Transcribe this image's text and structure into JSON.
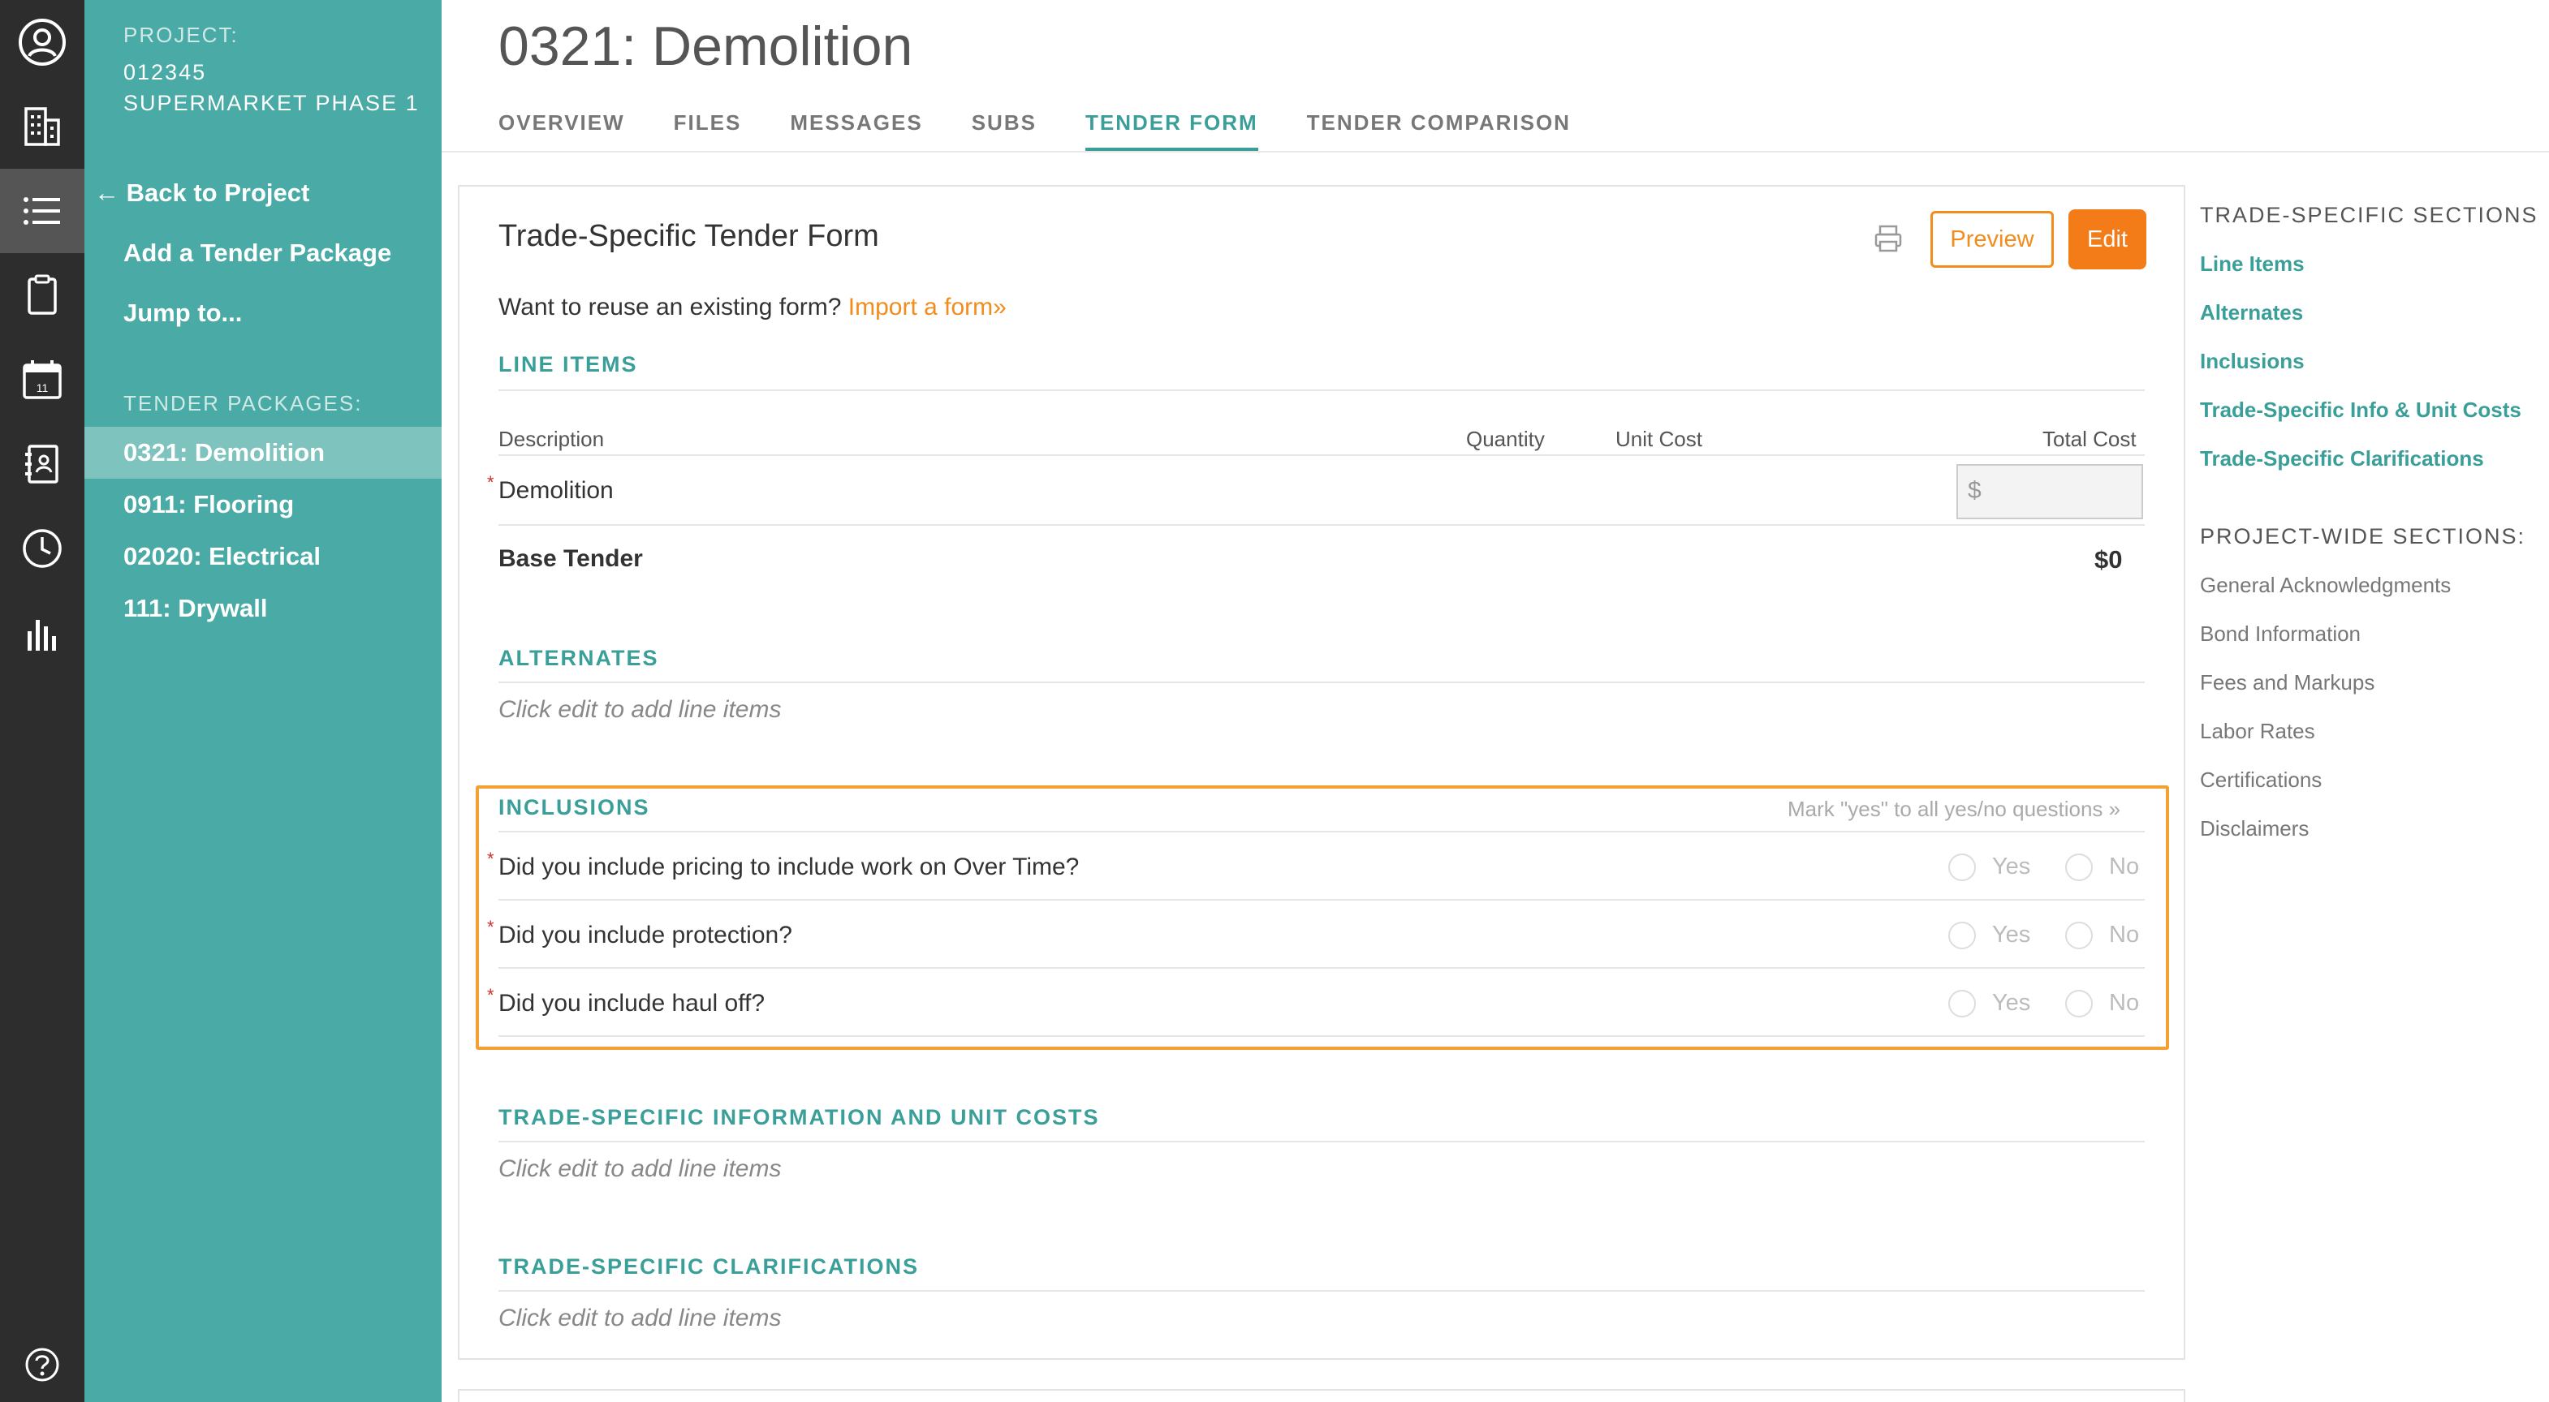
{
  "rail": {
    "items": [
      {
        "icon": "user-icon"
      },
      {
        "icon": "building-icon"
      },
      {
        "icon": "list-icon"
      },
      {
        "icon": "clipboard-icon"
      },
      {
        "icon": "calendar-icon",
        "day": "11"
      },
      {
        "icon": "address-book-icon"
      },
      {
        "icon": "clock-icon"
      },
      {
        "icon": "bar-chart-icon"
      },
      {
        "icon": "help-icon"
      }
    ]
  },
  "sidebar": {
    "project_label": "PROJECT:",
    "project_number": "012345",
    "project_name": "SUPERMARKET PHASE 1",
    "back_link": "← Back to Project",
    "add_package": "Add a Tender Package",
    "jump_to": "Jump to...",
    "packages_label": "TENDER PACKAGES:",
    "packages": [
      "0321: Demolition",
      "0911: Flooring",
      "02020: Electrical",
      "111: Drywall"
    ],
    "active_package": "0321: Demolition"
  },
  "header": {
    "title": "0321: Demolition",
    "tabs": [
      "OVERVIEW",
      "FILES",
      "MESSAGES",
      "SUBS",
      "TENDER FORM",
      "TENDER COMPARISON"
    ],
    "active_tab": "TENDER FORM"
  },
  "form": {
    "title": "Trade-Specific Tender Form",
    "preview_label": "Preview",
    "edit_label": "Edit",
    "reuse_text": "Want to reuse an existing form?",
    "import_link": "Import a form»",
    "line_items": {
      "heading": "LINE ITEMS",
      "columns": {
        "description": "Description",
        "quantity": "Quantity",
        "unit_cost": "Unit Cost",
        "total_cost": "Total Cost"
      },
      "row": {
        "description": "Demolition",
        "input_placeholder": "$"
      },
      "base_label": "Base Tender",
      "base_total": "$0"
    },
    "alternates": {
      "heading": "ALTERNATES",
      "empty": "Click edit to add line items"
    },
    "inclusions": {
      "heading": "INCLUSIONS",
      "mark_yes": "Mark \"yes\" to all yes/no questions »",
      "yes_label": "Yes",
      "no_label": "No",
      "questions": [
        "Did you include pricing to include work on Over Time?",
        "Did you include protection?",
        "Did you include haul off?"
      ]
    },
    "trade_info": {
      "heading": "TRADE-SPECIFIC INFORMATION AND UNIT COSTS",
      "empty": "Click edit to add line items"
    },
    "clarifications": {
      "heading": "TRADE-SPECIFIC CLARIFICATIONS",
      "empty": "Click edit to add line items"
    }
  },
  "right_nav": {
    "trade_heading": "TRADE-SPECIFIC SECTIONS",
    "trade_links": [
      "Line Items",
      "Alternates",
      "Inclusions",
      "Trade-Specific Info & Unit Costs",
      "Trade-Specific Clarifications"
    ],
    "project_heading": "PROJECT-WIDE SECTIONS:",
    "project_items": [
      "General Acknowledgments",
      "Bond Information",
      "Fees and Markups",
      "Labor Rates",
      "Certifications",
      "Disclaimers"
    ]
  },
  "colors": {
    "teal": "#4aaba6",
    "accent_teal": "#3a9e99",
    "orange": "#f47c18",
    "rail": "#2d2d2d"
  }
}
